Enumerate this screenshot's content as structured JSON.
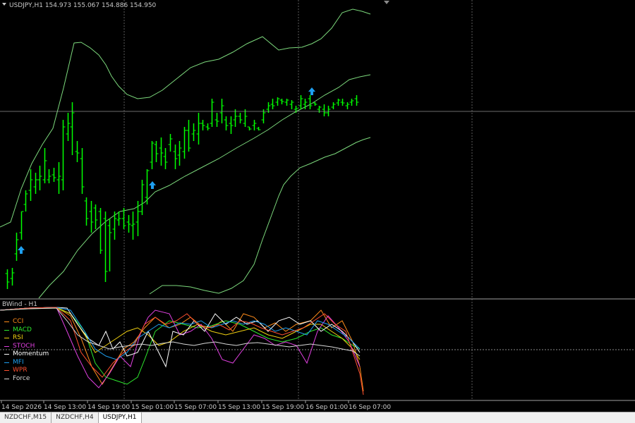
{
  "main_chart": {
    "header": "USDJPY,H1  154.973 155.067 154.886 154.950",
    "bar_color": "#00ff00",
    "band_color": "#7cd87c",
    "arrow_color": "#1e9ff0"
  },
  "subwindow": {
    "header": "BWind - H1"
  },
  "legend": [
    {
      "name": "CCI",
      "color": "#ff8c1a"
    },
    {
      "name": "MACD",
      "color": "#2ee82e"
    },
    {
      "name": "RSI",
      "color": "#f0d010"
    },
    {
      "name": "STOCH",
      "color": "#e040e0"
    },
    {
      "name": "Momentum",
      "color": "#ffffff"
    },
    {
      "name": "MFI",
      "color": "#1e9ff0"
    },
    {
      "name": "WPR",
      "color": "#ff5030"
    },
    {
      "name": "Force",
      "color": "#d8d8d8"
    }
  ],
  "time_axis": [
    "14 Sep 2026",
    "14 Sep 13:00",
    "14 Sep 19:00",
    "15 Sep 01:00",
    "15 Sep 07:00",
    "15 Sep 13:00",
    "15 Sep 19:00",
    "16 Sep 01:00",
    "16 Sep 07:00"
  ],
  "tabs": [
    "NZDCHF,M15",
    "NZDCHF,H4",
    "USDJPY,H1"
  ],
  "active_tab": 2,
  "chart_data": {
    "type": "line",
    "symbol": "USDJPY",
    "timeframe": "H1",
    "ohlc_header": [
      154.973,
      155.067,
      154.886,
      154.95
    ],
    "price_bars": [
      {
        "h": 382,
        "l": 410,
        "o": 388,
        "c": 400
      },
      {
        "h": 380,
        "l": 405,
        "o": 395,
        "c": 387
      },
      {
        "h": 330,
        "l": 370,
        "o": 360,
        "c": 340
      },
      {
        "h": 300,
        "l": 340,
        "o": 330,
        "c": 300
      },
      {
        "h": 270,
        "l": 300,
        "o": 290,
        "c": 275
      },
      {
        "h": 240,
        "l": 285,
        "o": 270,
        "c": 255
      },
      {
        "h": 245,
        "l": 275,
        "o": 265,
        "c": 255
      },
      {
        "h": 235,
        "l": 270,
        "o": 255,
        "c": 250
      },
      {
        "h": 210,
        "l": 260,
        "o": 255,
        "c": 228
      },
      {
        "h": 240,
        "l": 260,
        "o": 255,
        "c": 250
      },
      {
        "h": 238,
        "l": 258,
        "o": 248,
        "c": 252
      },
      {
        "h": 230,
        "l": 275,
        "o": 255,
        "c": 250
      },
      {
        "h": 170,
        "l": 270,
        "o": 255,
        "c": 180
      },
      {
        "h": 160,
        "l": 200,
        "o": 190,
        "c": 175
      },
      {
        "h": 145,
        "l": 220,
        "o": 180,
        "c": 160
      },
      {
        "h": 200,
        "l": 230,
        "o": 215,
        "c": 217
      },
      {
        "h": 210,
        "l": 275,
        "o": 225,
        "c": 265
      },
      {
        "h": 280,
        "l": 320,
        "o": 285,
        "c": 310
      },
      {
        "h": 285,
        "l": 330,
        "o": 300,
        "c": 315
      },
      {
        "h": 290,
        "l": 325,
        "o": 295,
        "c": 312
      },
      {
        "h": 295,
        "l": 360,
        "o": 300,
        "c": 355
      },
      {
        "h": 300,
        "l": 400,
        "o": 310,
        "c": 385
      },
      {
        "h": 310,
        "l": 385,
        "o": 320,
        "c": 330
      },
      {
        "h": 300,
        "l": 340,
        "o": 325,
        "c": 310
      },
      {
        "h": 300,
        "l": 320,
        "o": 312,
        "c": 310
      },
      {
        "h": 295,
        "l": 325,
        "o": 310,
        "c": 320
      },
      {
        "h": 305,
        "l": 330,
        "o": 315,
        "c": 318
      },
      {
        "h": 300,
        "l": 340,
        "o": 320,
        "c": 318
      },
      {
        "h": 285,
        "l": 335,
        "o": 315,
        "c": 300
      },
      {
        "h": 255,
        "l": 305,
        "o": 300,
        "c": 262
      },
      {
        "h": 240,
        "l": 290,
        "o": 280,
        "c": 242
      },
      {
        "h": 200,
        "l": 240,
        "o": 230,
        "c": 203
      },
      {
        "h": 200,
        "l": 230,
        "o": 205,
        "c": 218
      },
      {
        "h": 195,
        "l": 235,
        "o": 210,
        "c": 217
      },
      {
        "h": 210,
        "l": 240,
        "o": 222,
        "c": 230
      },
      {
        "h": 190,
        "l": 215,
        "o": 205,
        "c": 197
      },
      {
        "h": 205,
        "l": 240,
        "o": 215,
        "c": 225
      },
      {
        "h": 200,
        "l": 235,
        "o": 220,
        "c": 210
      },
      {
        "h": 180,
        "l": 225,
        "o": 215,
        "c": 185
      },
      {
        "h": 170,
        "l": 215,
        "o": 185,
        "c": 210
      },
      {
        "h": 175,
        "l": 200,
        "o": 190,
        "c": 185
      },
      {
        "h": 160,
        "l": 205,
        "o": 190,
        "c": 175
      },
      {
        "h": 170,
        "l": 185,
        "o": 175,
        "c": 178
      },
      {
        "h": 175,
        "l": 185,
        "o": 180,
        "c": 182
      },
      {
        "h": 140,
        "l": 180,
        "o": 175,
        "c": 145
      },
      {
        "h": 160,
        "l": 180,
        "o": 170,
        "c": 172
      },
      {
        "h": 140,
        "l": 175,
        "o": 160,
        "c": 150
      },
      {
        "h": 165,
        "l": 185,
        "o": 170,
        "c": 178
      },
      {
        "h": 165,
        "l": 190,
        "o": 175,
        "c": 178
      },
      {
        "h": 155,
        "l": 180,
        "o": 170,
        "c": 165
      },
      {
        "h": 160,
        "l": 175,
        "o": 165,
        "c": 170
      },
      {
        "h": 155,
        "l": 180,
        "o": 175,
        "c": 165
      },
      {
        "h": 180,
        "l": 185,
        "o": 180,
        "c": 183
      },
      {
        "h": 170,
        "l": 185,
        "o": 178,
        "c": 175
      },
      {
        "h": 180,
        "l": 185,
        "o": 182,
        "c": 184
      },
      {
        "h": 155,
        "l": 175,
        "o": 170,
        "c": 160
      },
      {
        "h": 145,
        "l": 160,
        "o": 155,
        "c": 150
      },
      {
        "h": 140,
        "l": 155,
        "o": 148,
        "c": 150
      },
      {
        "h": 138,
        "l": 150,
        "o": 145,
        "c": 140
      },
      {
        "h": 140,
        "l": 148,
        "o": 142,
        "c": 144
      },
      {
        "h": 140,
        "l": 150,
        "o": 145,
        "c": 142
      },
      {
        "h": 142,
        "l": 155,
        "o": 148,
        "c": 145
      },
      {
        "h": 150,
        "l": 160,
        "o": 155,
        "c": 154
      },
      {
        "h": 135,
        "l": 155,
        "o": 150,
        "c": 140
      },
      {
        "h": 140,
        "l": 155,
        "o": 148,
        "c": 145
      },
      {
        "h": 135,
        "l": 155,
        "o": 140,
        "c": 150
      },
      {
        "h": 145,
        "l": 150,
        "o": 146,
        "c": 148
      },
      {
        "h": 150,
        "l": 160,
        "o": 155,
        "c": 152
      },
      {
        "h": 148,
        "l": 165,
        "o": 155,
        "c": 160
      },
      {
        "h": 150,
        "l": 165,
        "o": 160,
        "c": 155
      },
      {
        "h": 145,
        "l": 155,
        "o": 152,
        "c": 148
      },
      {
        "h": 140,
        "l": 150,
        "o": 146,
        "c": 142
      },
      {
        "h": 140,
        "l": 150,
        "o": 145,
        "c": 146
      },
      {
        "h": 145,
        "l": 155,
        "o": 150,
        "c": 148
      },
      {
        "h": 140,
        "l": 150,
        "o": 145,
        "c": 143
      },
      {
        "h": 135,
        "l": 150,
        "o": 140,
        "c": 145
      }
    ],
    "arrows": [
      20,
      107,
      186
    ],
    "grid": "dotted",
    "crosshair": true
  }
}
